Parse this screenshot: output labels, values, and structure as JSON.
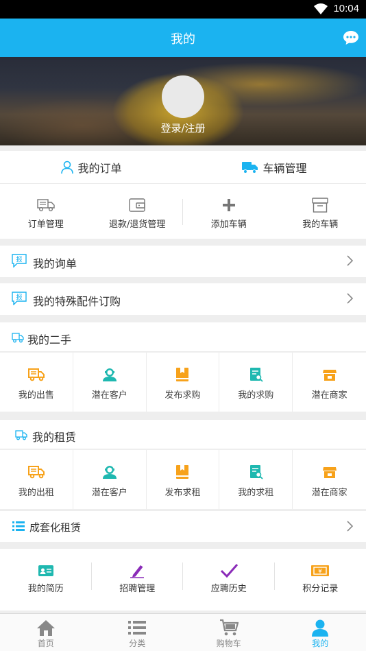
{
  "status_bar": {
    "time": "10:04"
  },
  "header": {
    "title": "我的"
  },
  "profile": {
    "login_label": "登录/注册"
  },
  "orders": {
    "my_orders": "我的订单",
    "vehicle_management": "车辆管理"
  },
  "quick_actions": [
    {
      "label": "订单管理",
      "icon": "truck-outline-icon"
    },
    {
      "label": "退款/退货管理",
      "icon": "wallet-icon"
    },
    {
      "label": "添加车辆",
      "icon": "plus-icon"
    },
    {
      "label": "我的车辆",
      "icon": "archive-box-icon"
    }
  ],
  "inquiry": {
    "label": "我的询单"
  },
  "special_parts": {
    "label": "我的特殊配件订购"
  },
  "second_hand": {
    "title": "我的二手",
    "items": [
      {
        "label": "我的出售",
        "icon": "truck-icon"
      },
      {
        "label": "潜在客户",
        "icon": "customer-icon"
      },
      {
        "label": "发布求购",
        "icon": "book-icon"
      },
      {
        "label": "我的求购",
        "icon": "document-search-icon"
      },
      {
        "label": "潜在商家",
        "icon": "store-icon"
      }
    ]
  },
  "rental": {
    "title": "我的租赁",
    "items": [
      {
        "label": "我的出租",
        "icon": "truck-icon"
      },
      {
        "label": "潜在客户",
        "icon": "customer-icon"
      },
      {
        "label": "发布求租",
        "icon": "book-icon"
      },
      {
        "label": "我的求租",
        "icon": "document-search-icon"
      },
      {
        "label": "潜在商家",
        "icon": "store-icon"
      }
    ]
  },
  "package_rental": {
    "label": "成套化租赁"
  },
  "jobs": [
    {
      "label": "我的简历",
      "icon": "id-card-icon"
    },
    {
      "label": "招聘管理",
      "icon": "pencil-icon"
    },
    {
      "label": "应聘历史",
      "icon": "checkmark-icon"
    },
    {
      "label": "积分记录",
      "icon": "points-ticket-icon"
    }
  ],
  "bottom_nav": [
    {
      "label": "首页",
      "icon": "home-icon"
    },
    {
      "label": "分类",
      "icon": "list-icon"
    },
    {
      "label": "购物车",
      "icon": "cart-icon"
    },
    {
      "label": "我的",
      "icon": "user-icon"
    }
  ],
  "colors": {
    "accent": "#1bb3f0",
    "orange": "#f7a21b",
    "teal": "#1fb8b0",
    "purple": "#8a2bb8"
  }
}
